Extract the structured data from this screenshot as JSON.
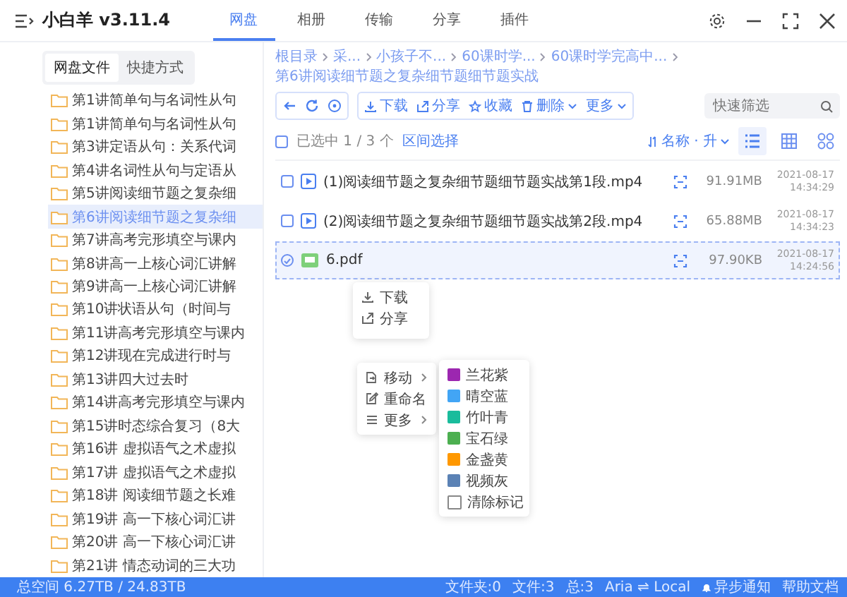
{
  "app": {
    "title": "小白羊 v3.11.4",
    "tabs": [
      {
        "label": "网盘",
        "selected": true
      },
      {
        "label": "相册",
        "selected": false
      },
      {
        "label": "传输",
        "selected": false
      },
      {
        "label": "分享",
        "selected": false
      },
      {
        "label": "插件",
        "selected": false
      }
    ]
  },
  "sidebar": {
    "tabs": [
      {
        "label": "网盘文件",
        "selected": true
      },
      {
        "label": "快捷方式",
        "selected": false
      }
    ],
    "items": [
      {
        "label": "第1讲简单句与名词性从句",
        "selected": false
      },
      {
        "label": "第1讲简单句与名词性从句",
        "selected": false
      },
      {
        "label": "第3讲定语从句：关系代词",
        "selected": false
      },
      {
        "label": "第4讲名词性从句与定语从",
        "selected": false
      },
      {
        "label": "第5讲阅读细节题之复杂细",
        "selected": false
      },
      {
        "label": "第6讲阅读细节题之复杂细",
        "selected": true
      },
      {
        "label": "第7讲高考完形填空与课内",
        "selected": false
      },
      {
        "label": "第8讲高一上核心词汇讲解",
        "selected": false
      },
      {
        "label": "第9讲高一上核心词汇讲解",
        "selected": false
      },
      {
        "label": "第10讲状语从句（时间与",
        "selected": false
      },
      {
        "label": "第11讲高考完形填空与课内",
        "selected": false
      },
      {
        "label": "第12讲现在完成进行时与",
        "selected": false
      },
      {
        "label": "第13讲四大过去时",
        "selected": false
      },
      {
        "label": "第14讲高考完形填空与课内",
        "selected": false
      },
      {
        "label": "第15讲时态综合复习（8大",
        "selected": false
      },
      {
        "label": "第16讲 虚拟语气之术虚拟",
        "selected": false
      },
      {
        "label": "第17讲 虚拟语气之术虚拟",
        "selected": false
      },
      {
        "label": "第18讲 阅读细节题之长难",
        "selected": false
      },
      {
        "label": "第19讲 高一下核心词汇讲",
        "selected": false
      },
      {
        "label": "第20讲 高一下核心词汇讲",
        "selected": false
      },
      {
        "label": "第21讲 情态动词的三大功",
        "selected": false
      }
    ]
  },
  "breadcrumb": [
    "根目录",
    "采...",
    "小孩子不...",
    "60课时学...",
    "60课时学完高中...",
    "第6讲阅读细节题之复杂细节题细节题实战"
  ],
  "toolbar": {
    "actions": [
      {
        "label": "下载",
        "kind": "download"
      },
      {
        "label": "分享",
        "kind": "share"
      },
      {
        "label": "收藏",
        "kind": "star"
      },
      {
        "label": "删除",
        "kind": "delete"
      },
      {
        "label": "更多",
        "kind": "more"
      }
    ],
    "search": {
      "placeholder": "快速筛选"
    }
  },
  "list_header": {
    "checked": false,
    "selection": "已选中 1 / 3 个",
    "range_link": "区间选择",
    "sort": "名称 · 升",
    "views": [
      {
        "kind": "list",
        "selected": true
      },
      {
        "kind": "grid",
        "selected": false
      },
      {
        "kind": "tiles",
        "selected": false
      }
    ]
  },
  "files": [
    {
      "name": "(1)阅读细节题之复杂细节题细节题实战第1段.mp4",
      "kind": "video",
      "checked": false,
      "size": "91.91MB",
      "date": "2021-08-17",
      "time": "14:34:29"
    },
    {
      "name": "(2)阅读细节题之复杂细节题细节题实战第2段.mp4",
      "kind": "video",
      "checked": false,
      "size": "65.88MB",
      "date": "2021-08-17",
      "time": "14:34:23"
    },
    {
      "name": "6.pdf",
      "kind": "pdf",
      "checked": true,
      "size": "97.90KB",
      "date": "2021-08-17",
      "time": "14:24:56"
    }
  ],
  "context_menu_top": [
    {
      "label": "下载",
      "kind": "download"
    },
    {
      "label": "分享",
      "kind": "share"
    }
  ],
  "context_menu": [
    {
      "label": "移动",
      "kind": "move",
      "submenu": true
    },
    {
      "label": "重命名",
      "kind": "rename",
      "submenu": false
    },
    {
      "label": "更多",
      "kind": "more",
      "submenu": true
    }
  ],
  "color_menu": [
    {
      "label": "兰花紫",
      "color": "#9c27b0"
    },
    {
      "label": "晴空蓝",
      "color": "#42a5f5"
    },
    {
      "label": "竹叶青",
      "color": "#1abc9c"
    },
    {
      "label": "宝石绿",
      "color": "#4caf50"
    },
    {
      "label": "金盏黄",
      "color": "#ff9800"
    },
    {
      "label": "视频灰",
      "color": "#5b82b5"
    },
    {
      "label": "清除标记",
      "kind": "clear"
    }
  ],
  "status_bar": {
    "space": "总空间 6.27TB / 24.83TB",
    "folders": "文件夹:0",
    "files": "文件:3",
    "total": "总:3",
    "aria": "Aria ⇌ Local",
    "notify": "异步通知",
    "help": "帮助文档"
  }
}
